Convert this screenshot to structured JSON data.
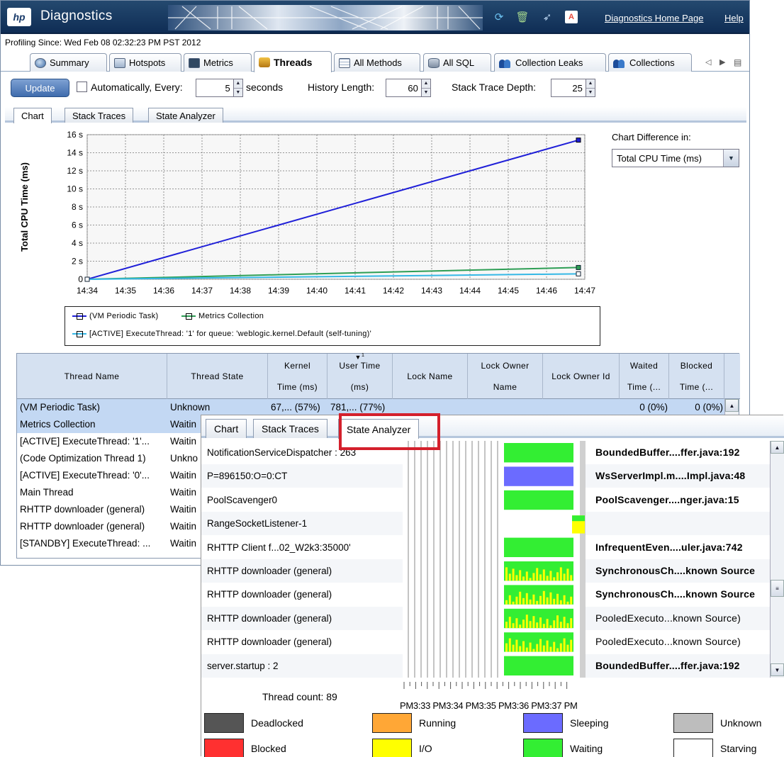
{
  "app": {
    "title": "Diagnostics",
    "logo": "hp",
    "links": {
      "home": "Diagnostics Home Page",
      "help": "Help"
    },
    "toolbar_icons": [
      "refresh-icon",
      "trash-icon",
      "bird-icon",
      "pdf-icon"
    ]
  },
  "profiling_since": "Profiling Since: Wed Feb 08 02:32:23 PM PST 2012",
  "main_tabs": [
    {
      "label": "Summary",
      "icon": "globe-icon"
    },
    {
      "label": "Hotspots",
      "icon": "list-icon"
    },
    {
      "label": "Metrics",
      "icon": "monitor-icon"
    },
    {
      "label": "Threads",
      "icon": "threads-icon",
      "selected": true
    },
    {
      "label": "All Methods",
      "icon": "grid-icon"
    },
    {
      "label": "All SQL",
      "icon": "database-icon"
    },
    {
      "label": "Collection Leaks",
      "icon": "people-icon"
    },
    {
      "label": "Collections",
      "icon": "people-icon"
    }
  ],
  "toolbar": {
    "update_label": "Update",
    "auto_label": "Automatically, Every:",
    "auto_value": "5",
    "seconds_label": "seconds",
    "history_label": "History Length:",
    "history_value": "60",
    "depth_label": "Stack Trace Depth:",
    "depth_value": "25"
  },
  "sub_tabs": [
    "Chart",
    "Stack Traces",
    "State Analyzer"
  ],
  "chart_controls": {
    "label": "Chart Difference in:",
    "value": "Total CPU Time (ms)"
  },
  "chart_data": {
    "type": "line",
    "ylabel": "Total CPU Time (ms)",
    "xlabel": "",
    "y_ticks": [
      "0",
      "2 s",
      "4 s",
      "6 s",
      "8 s",
      "10 s",
      "12 s",
      "14 s",
      "16 s"
    ],
    "ylim": [
      0,
      16
    ],
    "x_ticks": [
      "14:34",
      "14:35",
      "14:36",
      "14:37",
      "14:38",
      "14:39",
      "14:40",
      "14:41",
      "14:42",
      "14:43",
      "14:44",
      "14:45",
      "14:46",
      "14:47"
    ],
    "grid": true,
    "series": [
      {
        "name": "(VM Periodic Task)",
        "color": "#1f1fd8",
        "x": [
          "14:34",
          "14:46:50"
        ],
        "y": [
          0,
          15.4
        ]
      },
      {
        "name": "Metrics Collection",
        "color": "#2e9e55",
        "x": [
          "14:34",
          "14:46:50"
        ],
        "y": [
          0,
          1.3
        ]
      },
      {
        "name": "[ACTIVE] ExecuteThread: '1' for queue: 'weblogic.kernel.Default (self-tuning)'",
        "color": "#35b8e6",
        "x": [
          "14:34",
          "14:46:50"
        ],
        "y": [
          0,
          0.6
        ]
      }
    ]
  },
  "table": {
    "headers": [
      [
        "Thread Name"
      ],
      [
        "Thread State"
      ],
      [
        "Kernel",
        "Time (ms)"
      ],
      [
        "User Time",
        "(ms)"
      ],
      [
        "Lock Name"
      ],
      [
        "Lock Owner",
        "Name"
      ],
      [
        "Lock Owner Id"
      ],
      [
        "Waited",
        "Time (..."
      ],
      [
        "Blocked",
        "Time (..."
      ]
    ],
    "sort_marker": "1",
    "rows": [
      {
        "name": "(VM Periodic Task)",
        "state": "Unknown",
        "kernel": "67,... (57%)",
        "user": "781,... (77%)",
        "waited": "0 (0%)",
        "blocked": "0 (0%)"
      },
      {
        "name": "Metrics Collection",
        "state": "Waitin"
      },
      {
        "name": "[ACTIVE] ExecuteThread: '1'...",
        "state": "Waitin"
      },
      {
        "name": "(Code Optimization Thread 1)",
        "state": "Unkno"
      },
      {
        "name": "[ACTIVE] ExecuteThread: '0'...",
        "state": "Waitin"
      },
      {
        "name": "Main Thread",
        "state": "Waitin"
      },
      {
        "name": "RHTTP downloader (general)",
        "state": "Waitin"
      },
      {
        "name": "RHTTP downloader (general)",
        "state": "Waitin"
      },
      {
        "name": "[STANDBY] ExecuteThread: ...",
        "state": "Waitin"
      }
    ]
  },
  "state_analyzer": {
    "tabs": [
      "Chart",
      "Stack Traces",
      "State Analyzer"
    ],
    "rows": [
      {
        "name": "NotificationServiceDispatcher : 263",
        "stack": "BoundedBuffer....ffer.java:192",
        "bold": true
      },
      {
        "name": "P=896150:O=0:CT",
        "stack": "WsServerImpl.m....Impl.java:48",
        "bold": true
      },
      {
        "name": "PoolScavenger0",
        "stack": "PoolScavenger....nger.java:15",
        "bold": true
      },
      {
        "name": "RangeSocketListener-1",
        "stack": "",
        "bold": false
      },
      {
        "name": "RHTTP Client f...02_W2k3:35000'",
        "stack": "InfrequentEven....uler.java:742",
        "bold": true
      },
      {
        "name": "RHTTP downloader (general)",
        "stack": "SynchronousCh....known Source",
        "bold": true
      },
      {
        "name": "RHTTP downloader (general)",
        "stack": "SynchronousCh....known Source",
        "bold": true
      },
      {
        "name": "RHTTP downloader (general)",
        "stack": "PooledExecuto...known Source)",
        "bold": false
      },
      {
        "name": "RHTTP downloader (general)",
        "stack": "PooledExecuto...known Source)",
        "bold": false
      },
      {
        "name": "server.startup : 2",
        "stack": "BoundedBuffer....ffer.java:192",
        "bold": true
      }
    ],
    "thread_count": "Thread count: 89",
    "time_axis": "PM3:33 PM3:34 PM3:35 PM3:36 PM3:37 PM",
    "legend": [
      {
        "label": "Deadlocked",
        "color": "#555555"
      },
      {
        "label": "Running",
        "color": "#ffa736"
      },
      {
        "label": "Sleeping",
        "color": "#6b6bff"
      },
      {
        "label": "Unknown",
        "color": "#bdbdbd"
      },
      {
        "label": "Blocked",
        "color": "#ff3030"
      },
      {
        "label": "I/O",
        "color": "#ffff00"
      },
      {
        "label": "Waiting",
        "color": "#33ee33"
      },
      {
        "label": "Starving",
        "color": "#ffffff"
      }
    ]
  }
}
